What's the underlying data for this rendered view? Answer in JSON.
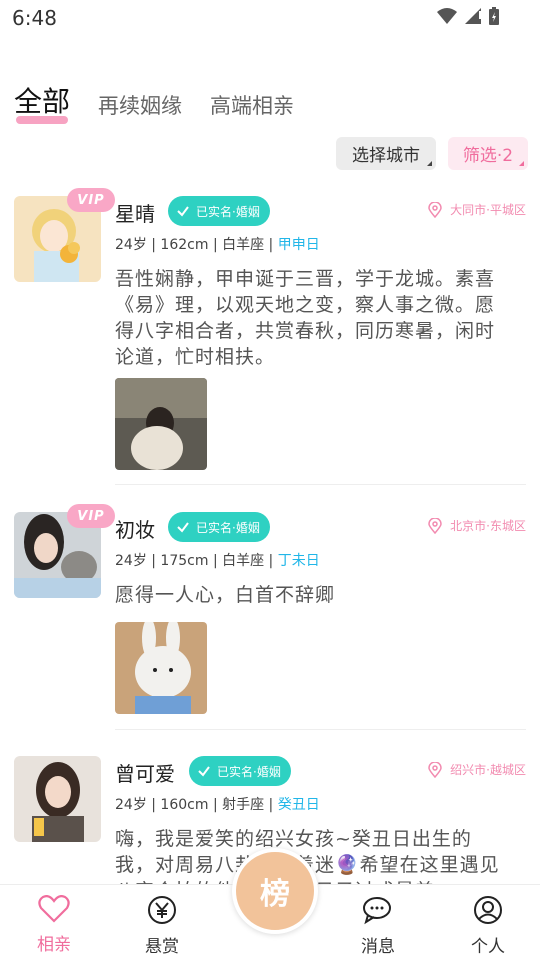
{
  "status": {
    "time": "6:48"
  },
  "tabs": [
    {
      "label": "全部"
    },
    {
      "label": "再续姻缘"
    },
    {
      "label": "高端相亲"
    }
  ],
  "filters": {
    "city_label": "选择城市",
    "filter_label": "筛选·2"
  },
  "cards": [
    {
      "name": "星晴",
      "vip": "VIP",
      "verify": "已实名·婚姻",
      "location": "大同市·平城区",
      "info": "24岁 | 162cm | 白羊座 | ",
      "day": "甲申日",
      "desc": "吾性娴静，甲申诞于三晋，学于龙城。素喜《易》理，以观天地之变，察人事之微。愿得八字相合者，共赏春秋，同历寒暑，闲时论道，忙时相扶。"
    },
    {
      "name": "初妆",
      "vip": "VIP",
      "verify": "已实名·婚姻",
      "location": "北京市·东城区",
      "info": "24岁 | 175cm | 白羊座 | ",
      "day": "丁未日",
      "desc": "愿得一人心，白首不辞卿"
    },
    {
      "name": "曾可爱",
      "verify": "已实名·婚姻",
      "location": "绍兴市·越城区",
      "info": "24岁 | 160cm | 射手座 | ",
      "day": "癸丑日",
      "desc": "嗨，我是爱笑的绍兴女孩~癸丑日出生的我，对周易八卦特别着迷🔮希望在这里遇见八字合拍的他，我们把日子过成最美"
    }
  ],
  "nav": {
    "items": [
      {
        "label": "相亲",
        "icon": "heart-icon"
      },
      {
        "label": "悬赏",
        "icon": "yuan-icon"
      },
      {
        "label": "消息",
        "icon": "chat-icon"
      },
      {
        "label": "个人",
        "icon": "person-icon"
      }
    ],
    "center_label": "榜"
  },
  "colors": {
    "accent_pink": "#f06d9d",
    "verify_teal": "#2ed1c2",
    "day_blue": "#21b6e8",
    "rank_orange": "#f2c39a"
  }
}
